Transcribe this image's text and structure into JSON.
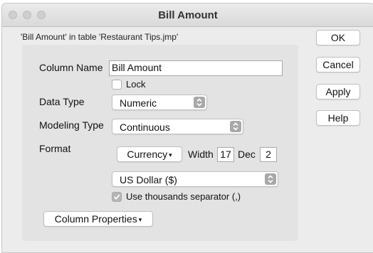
{
  "window": {
    "title": "Bill Amount",
    "subtitle": "'Bill Amount' in table 'Restaurant Tips.jmp'"
  },
  "form": {
    "column_name_label": "Column Name",
    "column_name_value": "Bill Amount",
    "lock_label": "Lock",
    "lock_checked": false,
    "data_type_label": "Data Type",
    "data_type_value": "Numeric",
    "modeling_type_label": "Modeling Type",
    "modeling_type_value": "Continuous",
    "format_label": "Format",
    "format_value": "Currency",
    "width_label": "Width",
    "width_value": "17",
    "dec_label": "Dec",
    "dec_value": "2",
    "currency_value": "US Dollar ($)",
    "thousands_label": "Use thousands separator (,)",
    "thousands_checked": true,
    "column_properties_label": "Column Properties"
  },
  "buttons": {
    "ok": "OK",
    "cancel": "Cancel",
    "apply": "Apply",
    "help": "Help"
  },
  "icons": {
    "dropdown_caret": "▾",
    "stepper": "up-down-chevrons",
    "checkmark": "check"
  }
}
